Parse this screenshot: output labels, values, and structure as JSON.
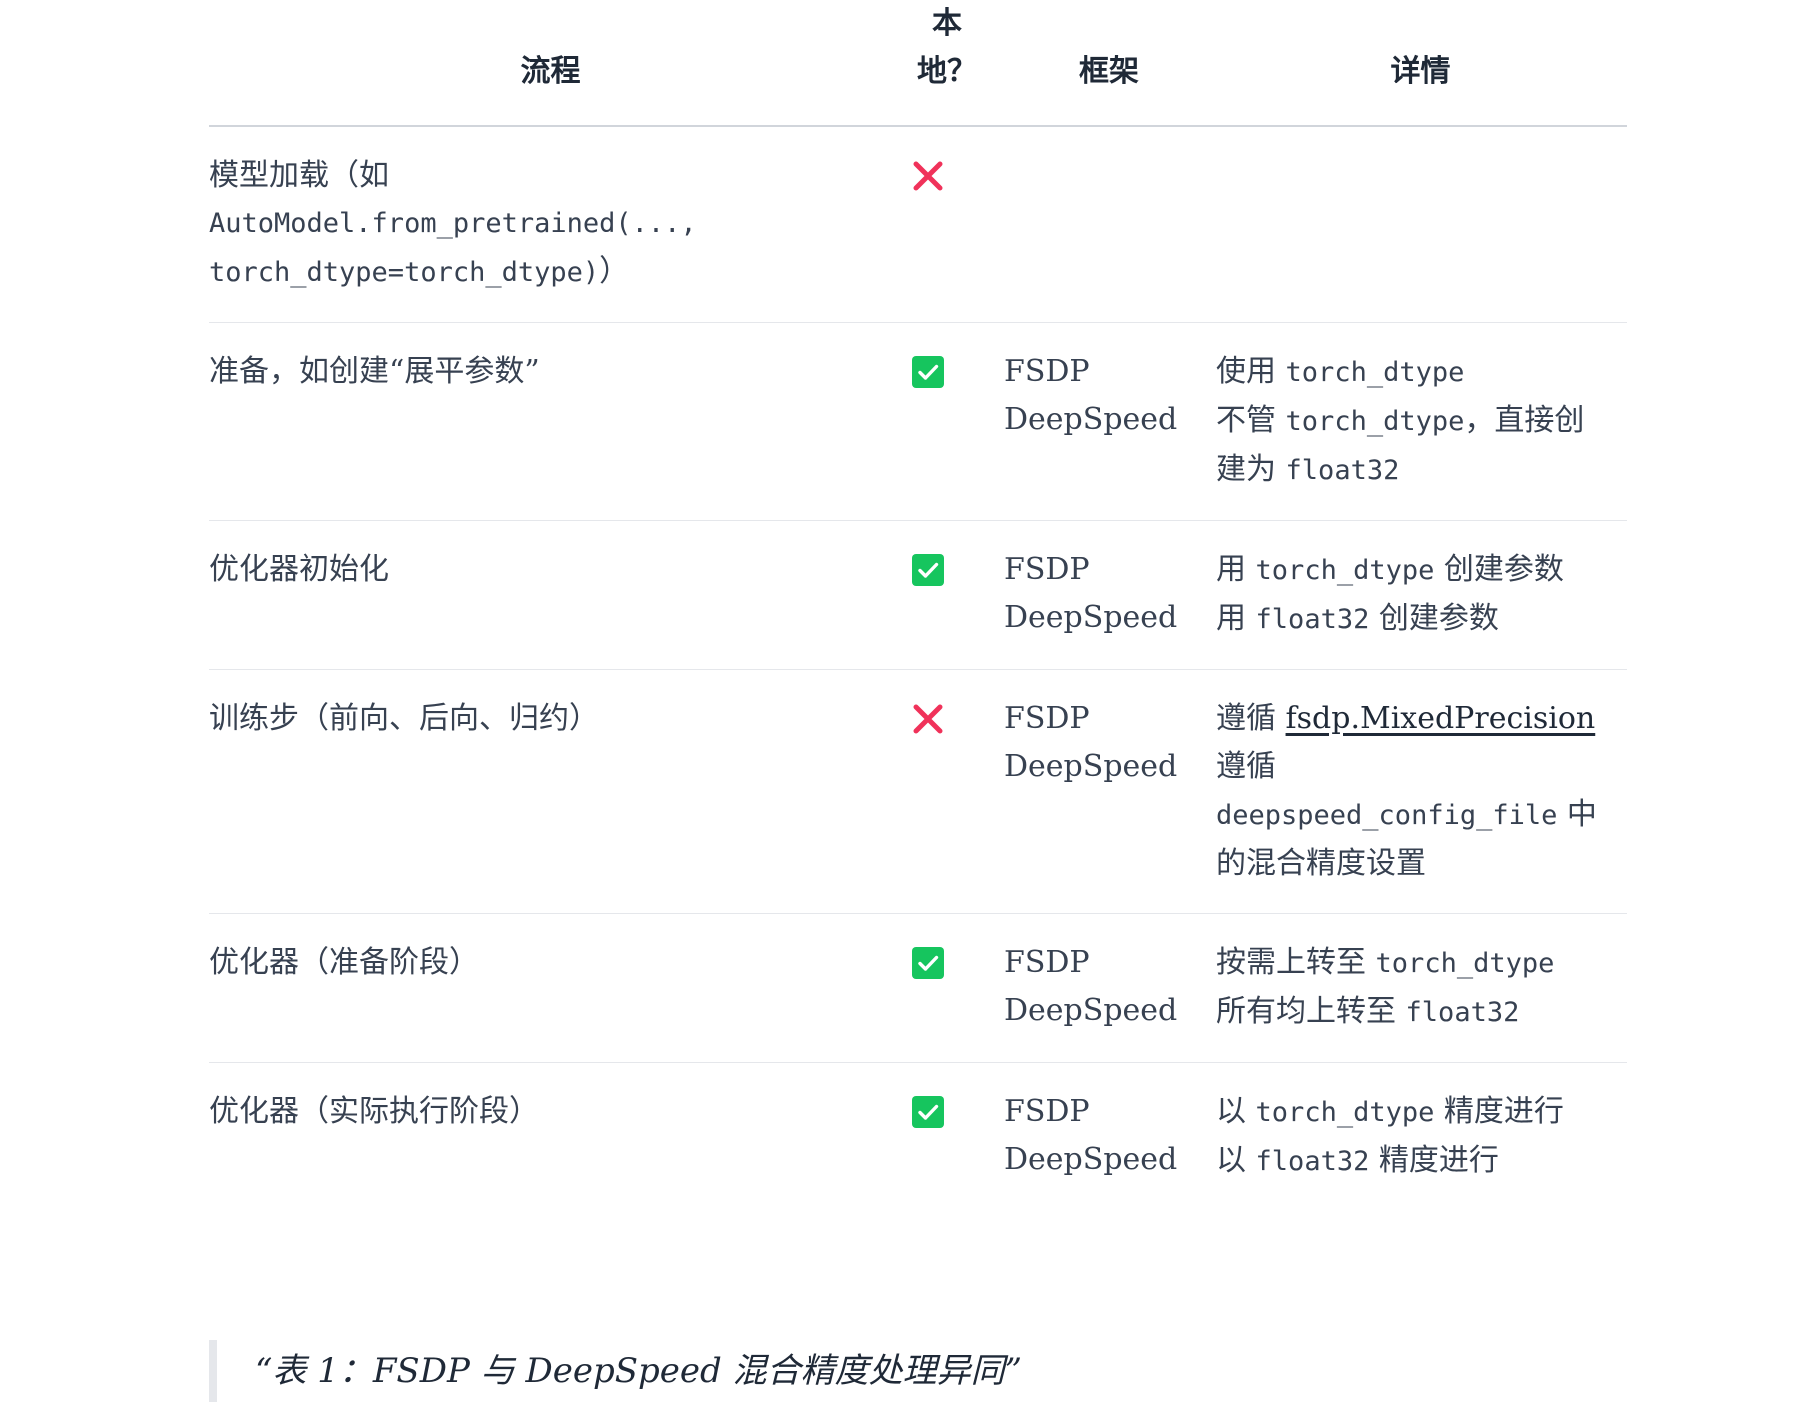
{
  "table": {
    "headers": {
      "process": "流程",
      "local_line1": "本",
      "local_line2": "地？",
      "framework": "框架",
      "details": "详情"
    },
    "rows": [
      {
        "process_lines": [
          "模型加载（如",
          "AutoModel.from_pretrained(...,",
          "torch_dtype=torch_dtype)）"
        ],
        "local": "cross",
        "frameworks": [],
        "details": []
      },
      {
        "process_lines": [
          "准备，如创建“展平参数”"
        ],
        "local": "check",
        "frameworks": [
          "FSDP",
          "DeepSpeed"
        ],
        "details": [
          [
            "使用 ",
            "torch_dtype",
            ""
          ],
          [
            "不管 ",
            "torch_dtype",
            "，直接创"
          ],
          [
            "建为 ",
            "float32",
            ""
          ]
        ]
      },
      {
        "process_lines": [
          "优化器初始化"
        ],
        "local": "check",
        "frameworks": [
          "FSDP",
          "DeepSpeed"
        ],
        "details": [
          [
            "用 ",
            "torch_dtype",
            " 创建参数"
          ],
          [
            "用 ",
            "float32",
            " 创建参数"
          ]
        ]
      },
      {
        "process_lines": [
          "训练步（前向、后向、归约）"
        ],
        "local": "cross",
        "frameworks": [
          "FSDP",
          "DeepSpeed"
        ],
        "details": {
          "line1_prefix": "遵循 ",
          "line1_link": "fsdp.MixedPrecision",
          "line2": "遵循",
          "line3_code": "deepspeed_config_file",
          "line3_suffix": " 中",
          "line4": "的混合精度设置"
        }
      },
      {
        "process_lines": [
          "优化器（准备阶段）"
        ],
        "local": "check",
        "frameworks": [
          "FSDP",
          "DeepSpeed"
        ],
        "details": [
          [
            "按需上转至 ",
            "torch_dtype",
            ""
          ],
          [
            "所有均上转至 ",
            "float32",
            ""
          ]
        ]
      },
      {
        "process_lines": [
          "优化器（实际执行阶段）"
        ],
        "local": "check",
        "frameworks": [
          "FSDP",
          "DeepSpeed"
        ],
        "details": [
          [
            "以 ",
            "torch_dtype",
            " 精度进行"
          ],
          [
            "以 ",
            "float32",
            " 精度进行"
          ]
        ]
      }
    ]
  },
  "caption": "“表 1：FSDP 与 DeepSpeed 混合精度处理异同”",
  "colors": {
    "check_bg": "#16c55e",
    "cross": "#f0325a",
    "text": "#374151",
    "rule": "#d1d5db"
  },
  "icons": {
    "check": "check-box-icon",
    "cross": "cross-icon"
  }
}
